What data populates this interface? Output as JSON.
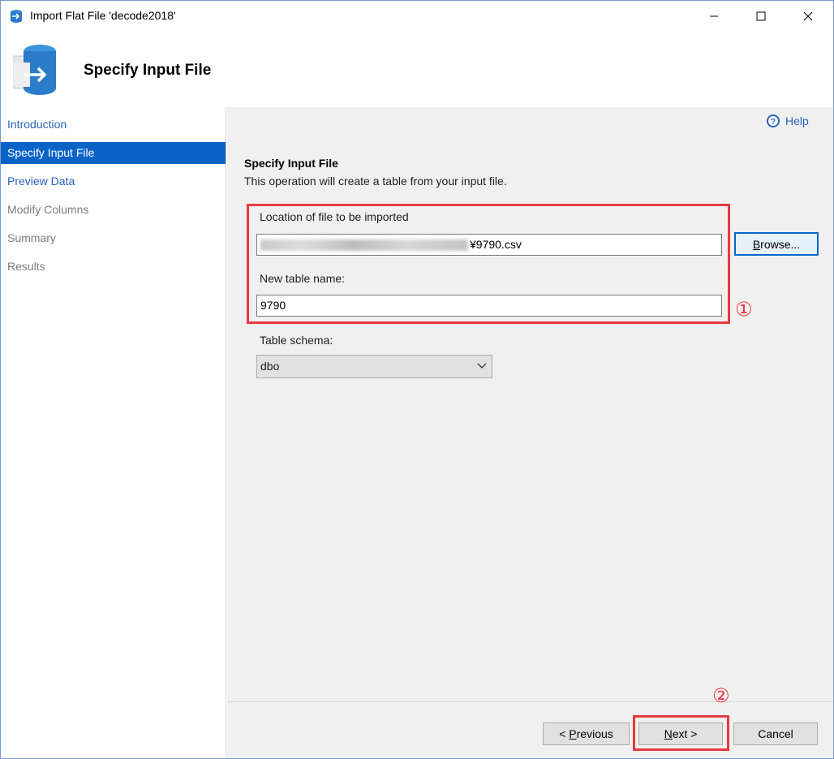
{
  "window": {
    "title": "Import Flat File 'decode2018'"
  },
  "header": {
    "title": "Specify Input File"
  },
  "nav": {
    "items": [
      {
        "label": "Introduction",
        "state": "link"
      },
      {
        "label": "Specify Input File",
        "state": "active"
      },
      {
        "label": "Preview Data",
        "state": "link"
      },
      {
        "label": "Modify Columns",
        "state": "disabled"
      },
      {
        "label": "Summary",
        "state": "disabled"
      },
      {
        "label": "Results",
        "state": "disabled"
      }
    ]
  },
  "main": {
    "help_label": "Help",
    "section_title": "Specify Input File",
    "section_desc": "This operation will create a table from your input file.",
    "file_location_label": "Location of file to be imported",
    "file_location_value_visible": "¥9790.csv",
    "browse_label": "Browse...",
    "browse_mnemonic": "B",
    "browse_rest": "rowse...",
    "table_name_label": "New table name:",
    "table_name_value": "9790",
    "schema_label": "Table schema:",
    "schema_value": "dbo"
  },
  "annotations": {
    "marker_1": "①",
    "marker_2": "②",
    "highlight_color": "#e8393f"
  },
  "footer": {
    "previous_prefix": "< ",
    "previous_mnemonic": "P",
    "previous_rest": "revious",
    "next_mnemonic": "N",
    "next_rest": "ext >",
    "cancel_label": "Cancel"
  },
  "colors": {
    "accent": "#0a64c8",
    "link": "#2c62b8",
    "panel": "#f0f0f0"
  }
}
